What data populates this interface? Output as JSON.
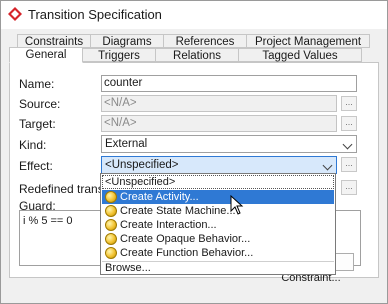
{
  "window": {
    "title": "Transition Specification"
  },
  "tabs": {
    "row1": [
      "Constraints",
      "Diagrams",
      "References",
      "Project Management"
    ],
    "row2": [
      "General",
      "Triggers",
      "Relations",
      "Tagged Values"
    ]
  },
  "form": {
    "name_label": "Name:",
    "name_value": "counter",
    "source_label": "Source:",
    "source_value": "<N/A>",
    "target_label": "Target:",
    "target_value": "<N/A>",
    "kind_label": "Kind:",
    "kind_value": "External",
    "effect_label": "Effect:",
    "effect_value": "<Unspecified>",
    "redefined_label": "Redefined transition:",
    "guard_label": "Guard:",
    "guard_value": "i % 5 == 0",
    "dots": "..."
  },
  "effect_dropdown": {
    "unspecified": "<Unspecified>",
    "items": [
      "Create Activity...",
      "Create State Machine...",
      "Create Interaction...",
      "Create Opaque Behavior...",
      "Create Function Behavior..."
    ],
    "selected_index": 0,
    "browse": "Browse..."
  },
  "buttons": {
    "select_constraint": "Select Constraint..."
  }
}
